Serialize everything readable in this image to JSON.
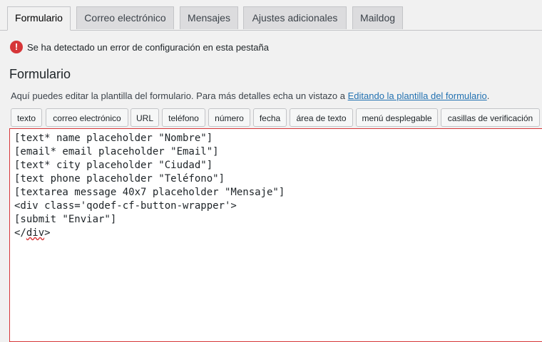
{
  "tabs": [
    {
      "label": "Formulario",
      "active": true
    },
    {
      "label": "Correo electrónico",
      "active": false
    },
    {
      "label": "Mensajes",
      "active": false
    },
    {
      "label": "Ajustes adicionales",
      "active": false
    },
    {
      "label": "Maildog",
      "active": false
    }
  ],
  "error": {
    "icon": "error-icon",
    "icon_glyph": "!",
    "message": "Se ha detectado un error de configuración en esta pestaña",
    "color": "#d63638"
  },
  "section": {
    "title": "Formulario",
    "description_prefix": "Aquí puedes editar la plantilla del formulario. Para más detalles echa un vistazo a ",
    "description_link": "Editando la plantilla del formulario",
    "description_suffix": "."
  },
  "tag_buttons": [
    "texto",
    "correo electrónico",
    "URL",
    "teléfono",
    "número",
    "fecha",
    "área de texto",
    "menú desplegable",
    "casillas de verificación"
  ],
  "editor": {
    "lines": [
      "[text* name placeholder \"Nombre\"]",
      "[email* email placeholder \"Email\"]",
      "[text* city placeholder \"Ciudad\"]",
      "[text phone placeholder \"Teléfono\"]",
      "[textarea message 40x7 placeholder \"Mensaje\"]",
      "<div class='qodef-cf-button-wrapper'>",
      "[submit \"Enviar\"]"
    ],
    "last_line_open": "</",
    "last_line_word": "div",
    "last_line_close": ">"
  },
  "colors": {
    "accent_link": "#2271b1",
    "error_border": "#d63638"
  }
}
